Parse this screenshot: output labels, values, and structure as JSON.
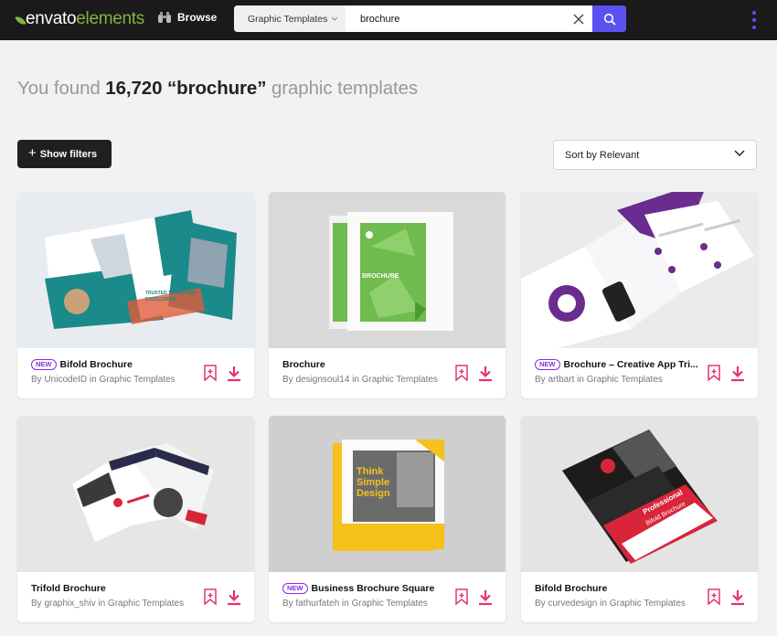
{
  "header": {
    "logo_main": "envato",
    "logo_sub": "elements",
    "browse_label": "Browse",
    "category_select": "Graphic Templates",
    "search_value": "brochure",
    "accent": "#5a52f0",
    "brand_green": "#82b541"
  },
  "results": {
    "prefix": "You found ",
    "count": "16,720",
    "query": "“brochure”",
    "suffix": " graphic templates"
  },
  "controls": {
    "filters_label": "Show filters",
    "sort_label": "Sort by Relevant"
  },
  "cards": [
    {
      "title": "Bifold Brochure",
      "is_new": true,
      "new_label": "NEW",
      "author": "By UnicodeID in Graphic Templates"
    },
    {
      "title": "Brochure",
      "is_new": false,
      "new_label": "",
      "author": "By designsoul14 in Graphic Templates"
    },
    {
      "title": "Brochure – Creative App Tri...",
      "is_new": true,
      "new_label": "NEW",
      "author": "By artbart in Graphic Templates"
    },
    {
      "title": "Trifold Brochure",
      "is_new": false,
      "new_label": "",
      "author": "By graphix_shiv in Graphic Templates"
    },
    {
      "title": "Business Brochure Square",
      "is_new": true,
      "new_label": "NEW",
      "author": "By fathurfateh in Graphic Templates"
    },
    {
      "title": "Bifold Brochure",
      "is_new": false,
      "new_label": "",
      "author": "By curvedesign in Graphic Templates"
    }
  ],
  "thumb_text": {
    "card0_a": "TRUSTED TO DELIVER",
    "card0_b": "EXCELLENCE",
    "card1": "BROCHURE",
    "card4_a": "Think",
    "card4_b": "Simple",
    "card4_c": "Design",
    "card5_a": "Professional",
    "card5_b": "Bifold Brochure"
  }
}
